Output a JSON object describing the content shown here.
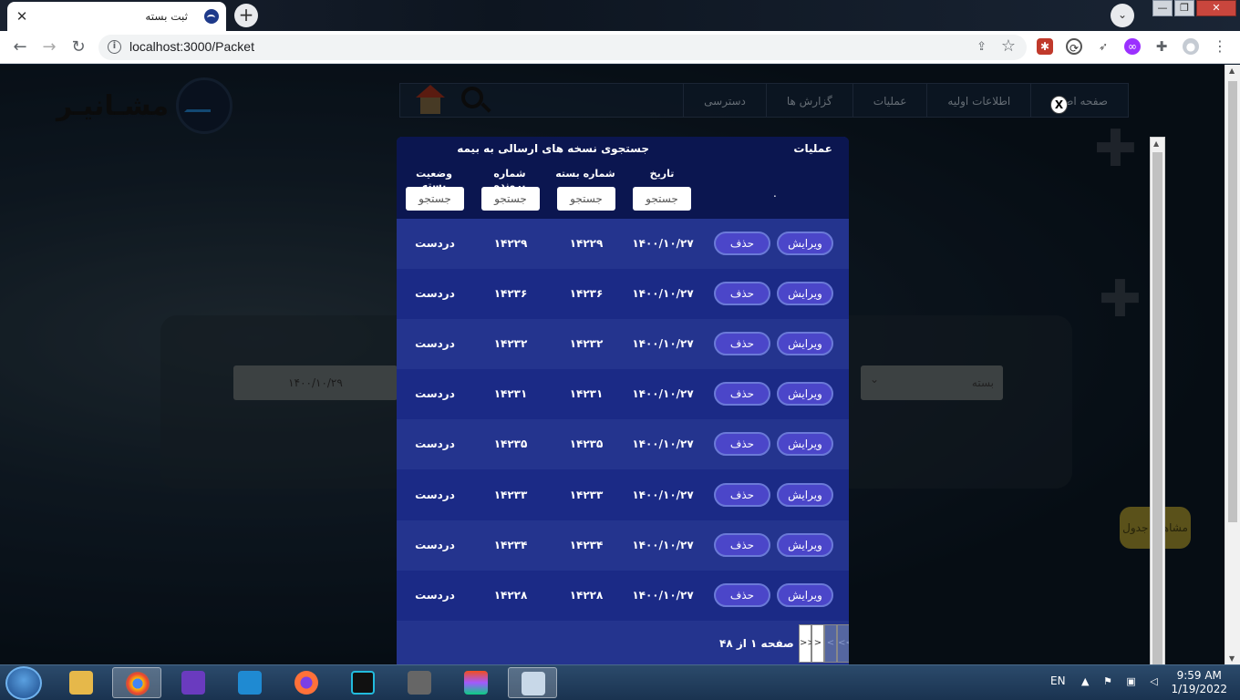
{
  "browser": {
    "tab_title": "ثبت بسته",
    "tab_close": "✕",
    "new_tab": "+",
    "url": "localhost:3000/Packet",
    "window_buttons": [
      "—",
      "❐",
      "✕"
    ]
  },
  "site": {
    "logo_text": "مشـانیـر",
    "nav_items": [
      "صفحه اصلی",
      "اطلاعات اولیه",
      "عملیات",
      "گزارش ها",
      "دسترسی"
    ],
    "nav_note": "صفحه اصلی partially hidden behind close button"
  },
  "background_form": {
    "date_value": "۱۴۰۰/۱۰/۲۹",
    "select_value": "بسته",
    "yellow_button": "مشاهده جدول"
  },
  "modal": {
    "close_label": "X",
    "operations_header": "عملیات",
    "title": "جستجوی نسخه های ارسالی به بیمه",
    "filter_marker": ".",
    "columns": {
      "date": "تاریخ",
      "packet_no": "شماره بسته",
      "file_no": "شماره پرونده",
      "status": "وضعیت بسته"
    },
    "search_placeholder": "جستجو",
    "edit_label": "ویرایش",
    "delete_label": "حذف",
    "rows": [
      {
        "date": "۱۴۰۰/۱۰/۲۷",
        "packet_no": "۱۴۲۲۹",
        "file_no": "۱۴۲۲۹",
        "status": "دردست اقدام"
      },
      {
        "date": "۱۴۰۰/۱۰/۲۷",
        "packet_no": "۱۴۲۳۶",
        "file_no": "۱۴۲۳۶",
        "status": "دردست اقدام"
      },
      {
        "date": "۱۴۰۰/۱۰/۲۷",
        "packet_no": "۱۴۲۳۲",
        "file_no": "۱۴۲۳۲",
        "status": "دردست اقدام"
      },
      {
        "date": "۱۴۰۰/۱۰/۲۷",
        "packet_no": "۱۴۲۳۱",
        "file_no": "۱۴۲۳۱",
        "status": "دردست اقدام"
      },
      {
        "date": "۱۴۰۰/۱۰/۲۷",
        "packet_no": "۱۴۲۳۵",
        "file_no": "۱۴۲۳۵",
        "status": "دردست اقدام"
      },
      {
        "date": "۱۴۰۰/۱۰/۲۷",
        "packet_no": "۱۴۲۳۳",
        "file_no": "۱۴۲۳۳",
        "status": "دردست اقدام"
      },
      {
        "date": "۱۴۰۰/۱۰/۲۷",
        "packet_no": "۱۴۲۳۴",
        "file_no": "۱۴۲۳۴",
        "status": "دردست اقدام"
      },
      {
        "date": "۱۴۰۰/۱۰/۲۷",
        "packet_no": "۱۴۲۲۸",
        "file_no": "۱۴۲۲۸",
        "status": "دردست اقدام"
      }
    ],
    "pager": {
      "info": "صفحه ۱ از ۴۸",
      "first": "<<",
      "prev": "<",
      "next": ">",
      "last": ">>"
    }
  },
  "taskbar": {
    "lang": "EN",
    "time": "9:59 AM",
    "date": "1/19/2022"
  },
  "colors": {
    "modal_bg": "#1b2a86",
    "modal_header": "#0b1650",
    "button": "#4b46c9"
  }
}
